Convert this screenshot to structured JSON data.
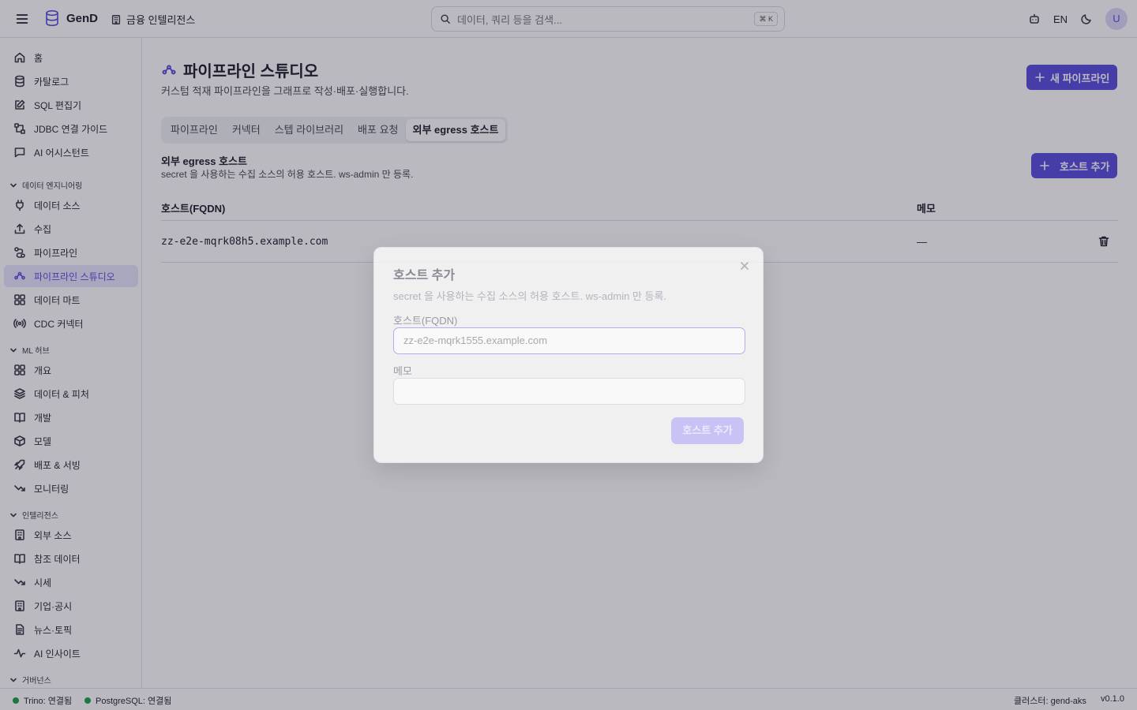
{
  "header": {
    "app_name": "GenD",
    "workspace": "금융 인텔리전스",
    "search_placeholder": "데이터, 쿼리 등을 검색...",
    "search_shortcut": "⌘ K",
    "lang": "EN",
    "avatar": "U"
  },
  "sidebar": {
    "top_items": [
      {
        "label": "홈",
        "icon": "home-icon"
      },
      {
        "label": "카탈로그",
        "icon": "database-icon"
      },
      {
        "label": "SQL 편집기",
        "icon": "edit-icon"
      },
      {
        "label": "JDBC 연결 가이드",
        "icon": "network-icon"
      },
      {
        "label": "AI 어시스턴트",
        "icon": "chat-icon"
      }
    ],
    "sections": [
      {
        "title": "데이터 엔지니어링",
        "items": [
          {
            "label": "데이터 소스",
            "icon": "plug-icon"
          },
          {
            "label": "수집",
            "icon": "upload-icon"
          },
          {
            "label": "파이프라인",
            "icon": "route-icon"
          },
          {
            "label": "파이프라인 스튜디오",
            "icon": "workflow-icon",
            "active": true
          },
          {
            "label": "데이터 마트",
            "icon": "grid-icon"
          },
          {
            "label": "CDC 커넥터",
            "icon": "radio-icon"
          }
        ]
      },
      {
        "title": "ML 허브",
        "items": [
          {
            "label": "개요",
            "icon": "grid-icon"
          },
          {
            "label": "데이터 & 피처",
            "icon": "layers-icon"
          },
          {
            "label": "개발",
            "icon": "book-icon"
          },
          {
            "label": "모델",
            "icon": "box-icon"
          },
          {
            "label": "배포 & 서빙",
            "icon": "rocket-icon"
          },
          {
            "label": "모니터링",
            "icon": "trend-icon"
          }
        ]
      },
      {
        "title": "인텔리전스",
        "items": [
          {
            "label": "외부 소스",
            "icon": "building-icon"
          },
          {
            "label": "참조 데이터",
            "icon": "book-icon"
          },
          {
            "label": "시세",
            "icon": "trend-icon"
          },
          {
            "label": "기업·공시",
            "icon": "building-icon"
          },
          {
            "label": "뉴스·토픽",
            "icon": "file-icon"
          },
          {
            "label": "AI 인사이트",
            "icon": "pulse-icon"
          }
        ]
      },
      {
        "title": "거버넌스",
        "items": []
      }
    ]
  },
  "main": {
    "title": "파이프라인 스튜디오",
    "subtitle": "커스텀 적재 파이프라인을 그래프로 작성·배포·실행합니다.",
    "new_pipeline_btn": "새 파이프라인",
    "tabs": [
      "파이프라인",
      "커넥터",
      "스텝 라이브러리",
      "배포 요청",
      "외부 egress 호스트"
    ],
    "active_tab": 4,
    "section_title": "외부 egress 호스트",
    "section_sub": "secret 을 사용하는 수집 소스의 허용 호스트. ws-admin 만 등록.",
    "add_host_btn": "호스트 추가",
    "table": {
      "columns": [
        "호스트(FQDN)",
        "메모"
      ],
      "rows": [
        {
          "host": "zz-e2e-mqrk08h5.example.com",
          "memo": "—"
        }
      ]
    }
  },
  "modal": {
    "title": "호스트 추가",
    "subtitle": "secret 을 사용하는 수집 소스의 허용 호스트. ws-admin 만 등록.",
    "host_label": "호스트(FQDN)",
    "host_placeholder": "zz-e2e-mqrk1555.example.com",
    "memo_label": "메모",
    "memo_value": "",
    "submit": "호스트 추가"
  },
  "statusbar": {
    "trino": "Trino: 연결됨",
    "postgres": "PostgreSQL: 연결됨",
    "cluster": "클러스터: gend-aks",
    "version": "v0.1.0"
  },
  "colors": {
    "accent": "#5b4ee0",
    "status_ok": "#22a04b"
  }
}
